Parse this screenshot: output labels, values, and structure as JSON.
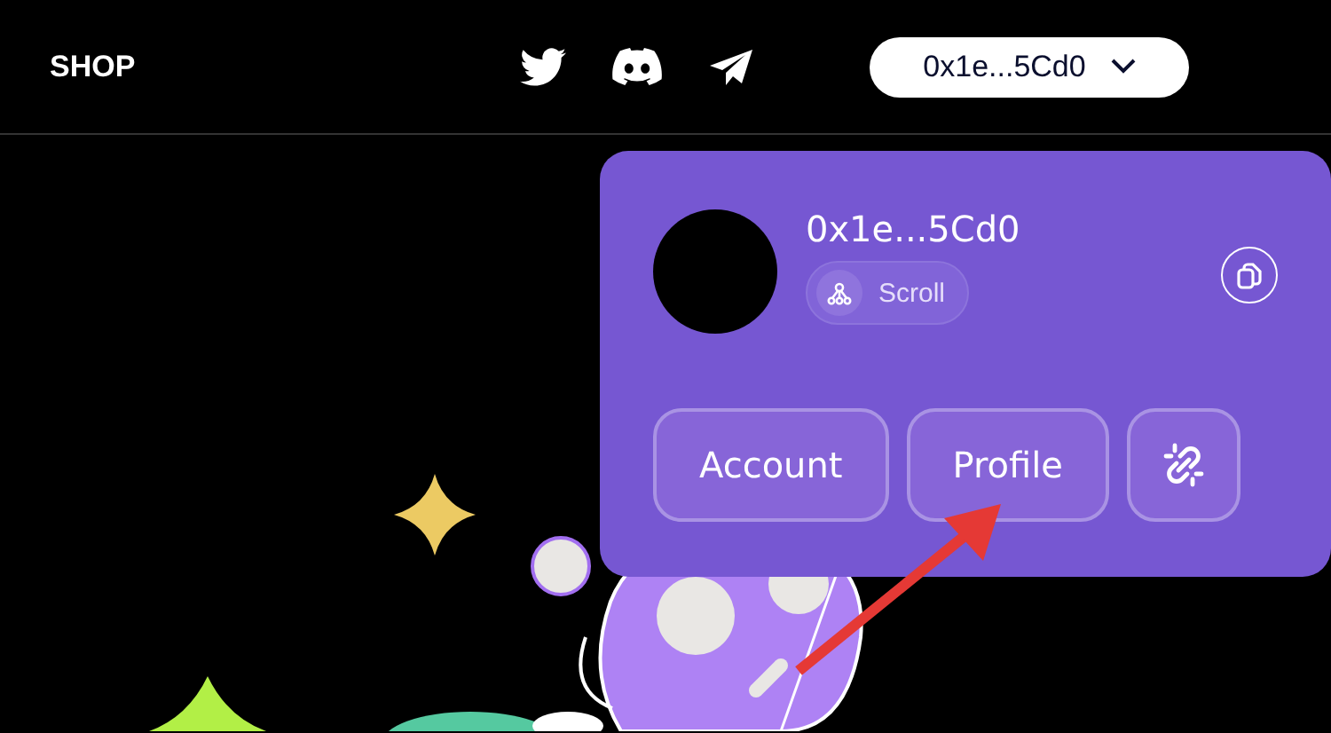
{
  "header": {
    "logo": "SHOP",
    "wallet_button": {
      "label": "0x1e...5Cd0"
    }
  },
  "wallet_popup": {
    "address": "0x1e...5Cd0",
    "network": {
      "name": "Scroll"
    },
    "buttons": [
      {
        "kind": "text",
        "label": "Account"
      },
      {
        "kind": "text",
        "label": "Profile"
      },
      {
        "kind": "disconnect"
      }
    ]
  }
}
